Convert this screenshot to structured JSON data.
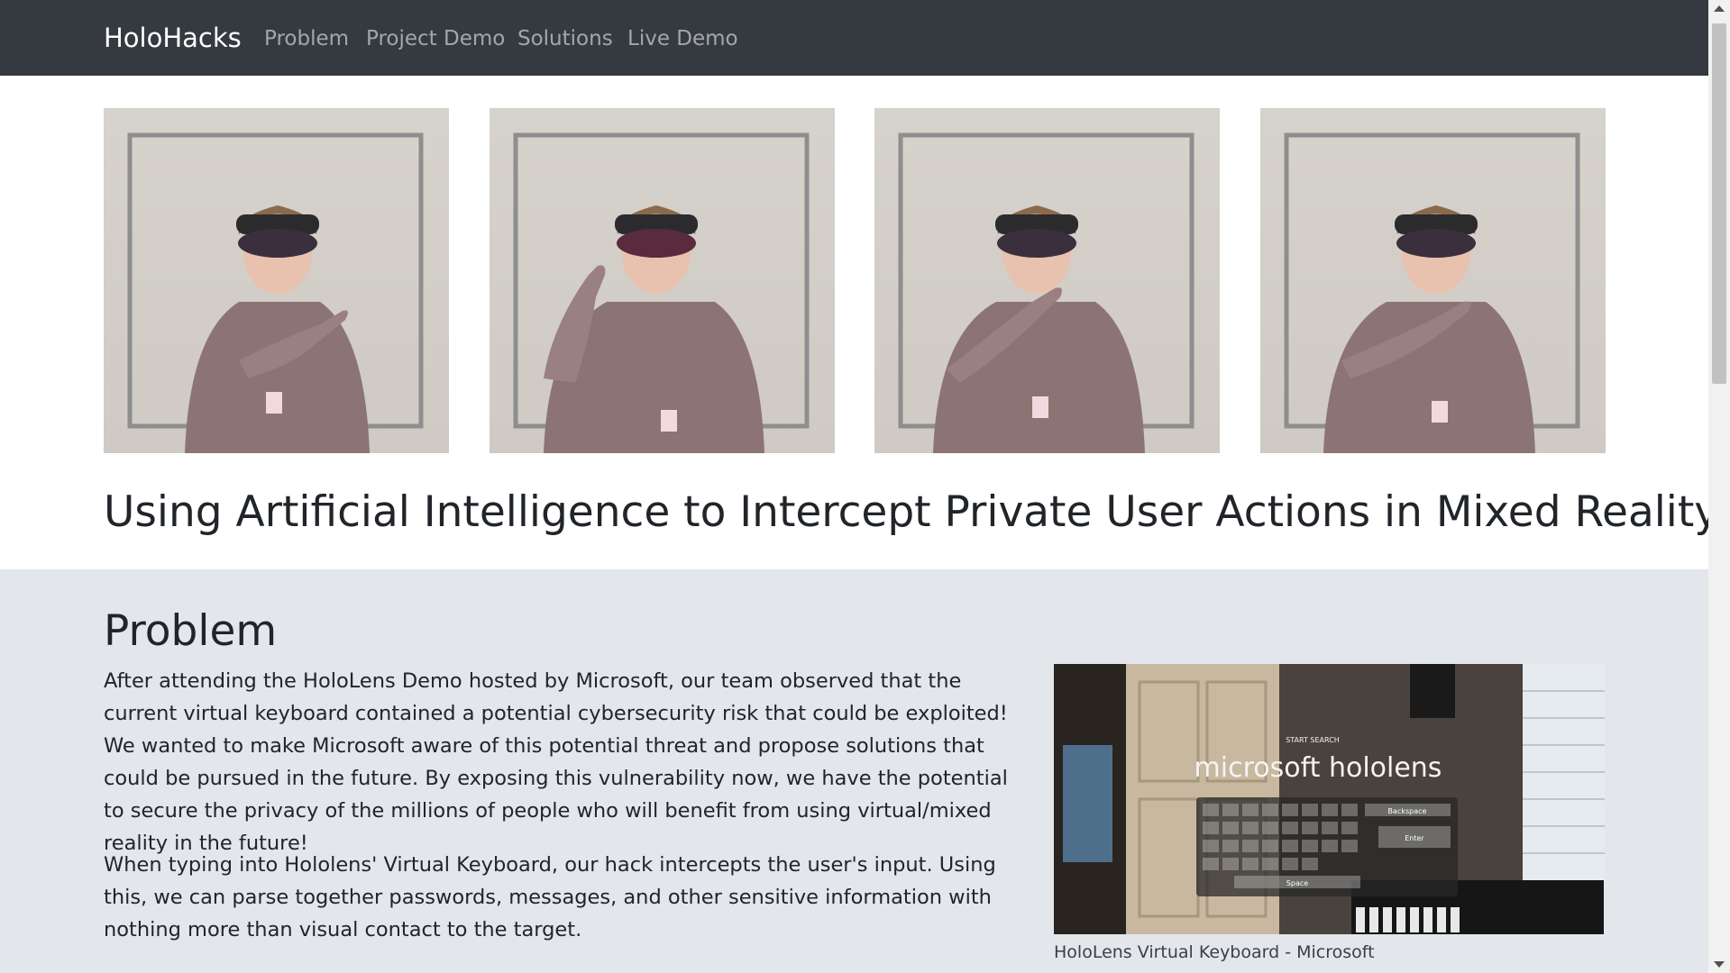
{
  "navbar": {
    "brand": "HoloHacks",
    "links": [
      "Problem",
      "Project Demo",
      "Solutions",
      "Live Demo"
    ]
  },
  "hero": {
    "title": "Using Artificial Intelligence to Intercept Private User Actions in Mixed Reality"
  },
  "problem": {
    "title": "Problem",
    "paragraphs": [
      "After attending the HoloLens Demo hosted by Microsoft, our team observed that the current virtual keyboard contained a potential cybersecurity risk that could be exploited! We wanted to make Microsoft aware of this potential threat and propose solutions that could be pursued in the future. By exposing this vulnerability now, we have the potential to secure the privacy of the millions of people who will benefit from using virtual/mixed reality in the future!",
      "When typing into Hololens' Virtual Keyboard, our hack intercepts the user's input. Using this, we can parse together passwords, messages, and other sensitive information with nothing more than visual contact to the target."
    ],
    "figure": {
      "overlay_title": "microsoft hololens",
      "overlay_hint": "START SEARCH",
      "keys": {
        "backspace": "Backspace",
        "enter": "Enter",
        "space": "Space"
      },
      "caption": "HoloLens Virtual Keyboard - Microsoft"
    }
  },
  "colors": {
    "navbar_bg": "#343a40",
    "section_bg": "#e3e7eb",
    "text": "#212529"
  }
}
